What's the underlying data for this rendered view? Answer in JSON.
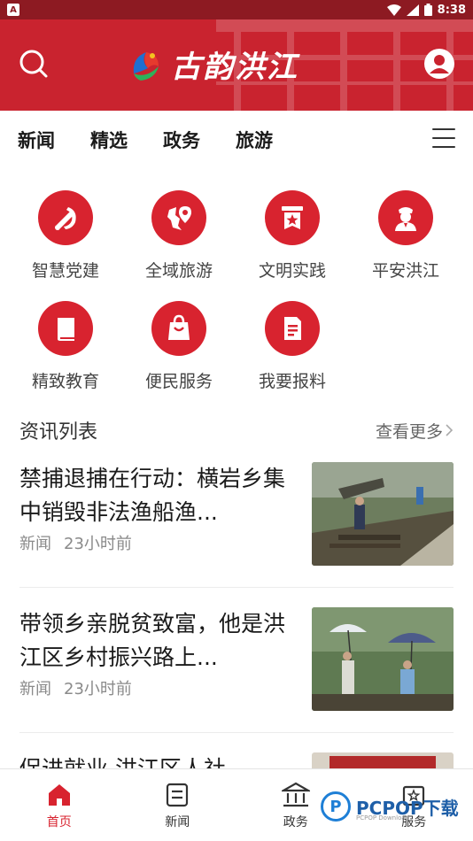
{
  "status_bar": {
    "time": "8:38"
  },
  "header": {
    "app_title": "古韵洪江"
  },
  "tabs": [
    {
      "label": "新闻"
    },
    {
      "label": "精选"
    },
    {
      "label": "政务"
    },
    {
      "label": "旅游"
    }
  ],
  "grid": [
    {
      "label": "智慧党建",
      "icon": "party-emblem-icon"
    },
    {
      "label": "全域旅游",
      "icon": "map-pin-icon"
    },
    {
      "label": "文明实践",
      "icon": "star-banner-icon"
    },
    {
      "label": "平安洪江",
      "icon": "police-officer-icon"
    },
    {
      "label": "精致教育",
      "icon": "book-icon"
    },
    {
      "label": "便民服务",
      "icon": "shopping-bag-icon"
    },
    {
      "label": "我要报料",
      "icon": "report-document-icon"
    }
  ],
  "section": {
    "title": "资讯列表",
    "more_label": "查看更多"
  },
  "news": [
    {
      "title": "禁捕退捕在行动：横岩乡集中销毁非法渔船渔...",
      "category": "新闻",
      "time": "23小时前"
    },
    {
      "title": "带领乡亲脱贫致富，他是洪江区乡村振兴路上...",
      "category": "新闻",
      "time": "23小时前"
    },
    {
      "title": "促进就业 洪江区人社"
    }
  ],
  "bottom_nav": [
    {
      "label": "首页",
      "icon": "home-icon",
      "active": true
    },
    {
      "label": "新闻",
      "icon": "news-icon",
      "active": false
    },
    {
      "label": "政务",
      "icon": "government-icon",
      "active": false
    },
    {
      "label": "服务",
      "icon": "service-icon",
      "active": false
    }
  ],
  "watermark": {
    "text": "PCPOP下载",
    "sub": "PCPOP Download"
  },
  "colors": {
    "brand_red": "#c9232f",
    "icon_red": "#d8232f"
  }
}
